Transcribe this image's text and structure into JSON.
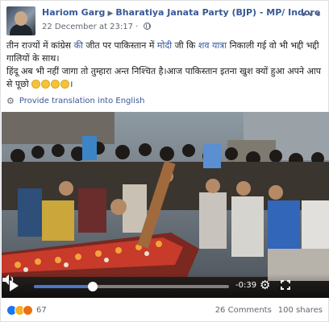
{
  "post": {
    "author": "Hariom Garg",
    "arrow": "▶",
    "page": "Bharatiya Janata Party (BJP) - MP/ Indore",
    "timestamp": "22 December at 23:17",
    "separator": "·",
    "more": "•••",
    "text": {
      "l1_a": "तीन राज्यों में कांग्रेस ",
      "l1_mention1": "की",
      "l1_b": " जीत पर पाकिस्तान में ",
      "l1_mention2": "मोदी",
      "l1_c": " जी कि ",
      "l1_mention3": "शव यात्रा",
      "l1_d": " निकाली गई वो भी भद्दी भद्दी गालियों के साथ।",
      "l2": "हिंदू अब भी नहीं जागा तो तुम्हारा अन्त निश्चित है।आज पाकिस्तान इतना खुश क्यों हुआ अपने आप से पूछो",
      "l2_end": "।"
    },
    "emojis": [
      "sad-face-emoji",
      "thinking-face-emoji",
      "crying-face-emoji",
      "angry-face-emoji"
    ],
    "translate_label": "Provide translation into English"
  },
  "video": {
    "progress": 0.3,
    "time_remaining": "-0:39"
  },
  "footer": {
    "reactions": [
      "like",
      "haha",
      "angry"
    ],
    "reaction_count": "67",
    "comments": "26 Comments",
    "shares": "100 shares"
  },
  "colors": {
    "link": "#385898",
    "progress": "#4a76c9",
    "like": "#1877f2"
  }
}
